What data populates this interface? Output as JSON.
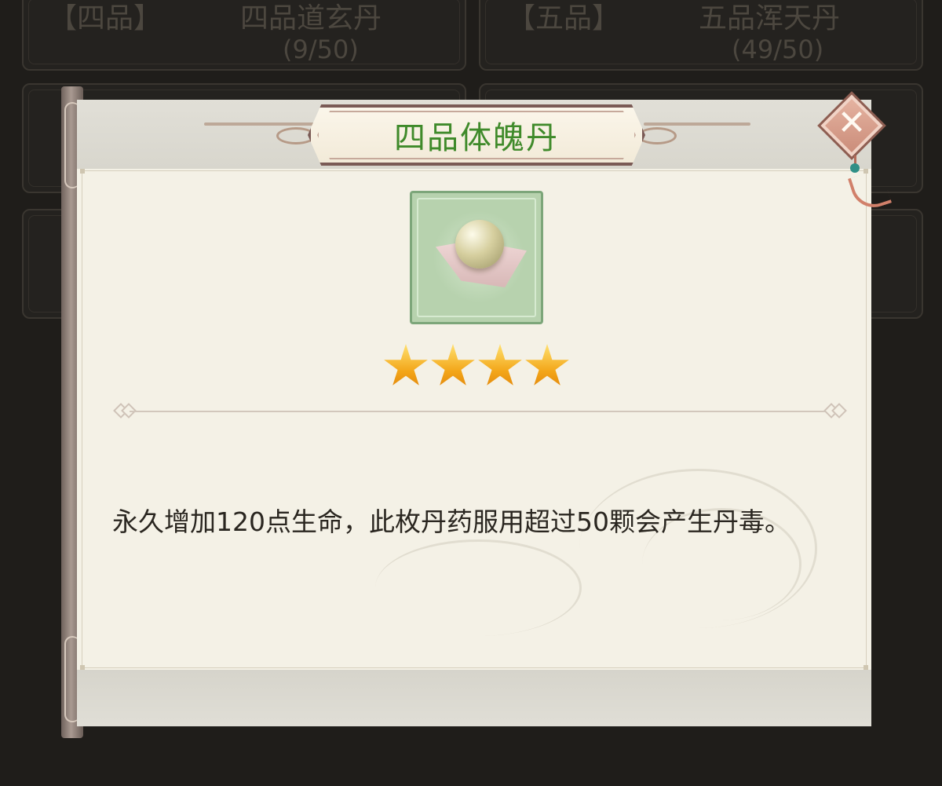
{
  "background": {
    "cards": [
      {
        "grade": "【四品】",
        "name": "四品道玄丹",
        "count": "(9/50)"
      },
      {
        "grade": "【五品】",
        "name": "五品浑天丹",
        "count": "(49/50)"
      }
    ]
  },
  "modal": {
    "title": "四品体魄丹",
    "close_icon": "close-x-icon",
    "item": {
      "icon": "pill-icon"
    },
    "stars": 4,
    "description": "永久增加120点生命，此枚丹药服用超过50颗会产生丹毒。"
  },
  "colors": {
    "title_text": "#3f8a2a",
    "star": "#f3a619",
    "panel_bg": "#f4f1e6"
  }
}
